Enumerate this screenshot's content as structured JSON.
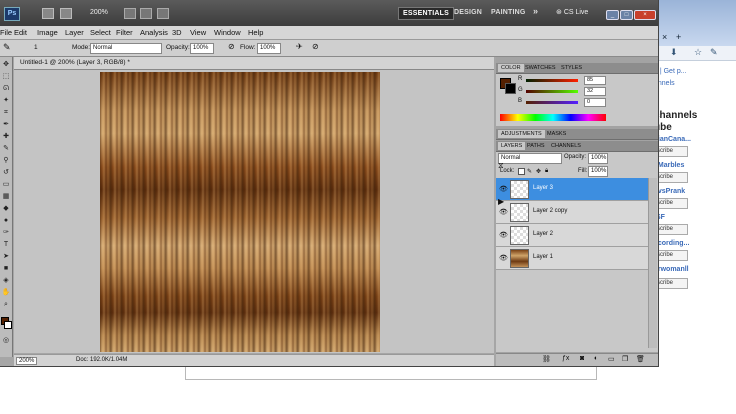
{
  "app": {
    "logo": "Ps",
    "zoom": "200%",
    "workspaces": [
      "ESSENTIALS",
      "DESIGN",
      "PAINTING"
    ],
    "more": "»",
    "cslive": "CS Live"
  },
  "menu": [
    "File",
    "Edit",
    "Image",
    "Layer",
    "Select",
    "Filter",
    "Analysis",
    "3D",
    "View",
    "Window",
    "Help"
  ],
  "options": {
    "size": "1",
    "mode_label": "Mode:",
    "mode_value": "Normal",
    "opacity_label": "Opacity:",
    "opacity_value": "100%",
    "flow_label": "Flow:",
    "flow_value": "100%"
  },
  "document": {
    "tab_title": "Untitled-1 @ 200% (Layer 3, RGB/8) *",
    "status_zoom": "200%",
    "status_doc": "Doc: 192.0K/1.04M"
  },
  "color_panel": {
    "tabs": [
      "COLOR",
      "SWATCHES",
      "STYLES"
    ],
    "r_label": "R",
    "r_value": "85",
    "g_label": "G",
    "g_value": "32",
    "b_label": "B",
    "b_value": "0",
    "foreground": "#552000"
  },
  "adjust_panel": {
    "tabs": [
      "ADJUSTMENTS",
      "MASKS"
    ]
  },
  "layers_panel": {
    "tabs": [
      "LAYERS",
      "PATHS",
      "CHANNELS"
    ],
    "blend": "Normal",
    "opacity_label": "Opacity:",
    "opacity_value": "100%",
    "lock_label": "Lock:",
    "fill_label": "Fill:",
    "fill_value": "100%",
    "layers": [
      "Layer 3",
      "Layer 2 copy",
      "Layer 2",
      "Layer 1"
    ]
  },
  "browser": {
    "stub_link": "n | Get p...",
    "stub_channels_text": "annels",
    "heading1": "channels",
    "heading2": "ube",
    "entries": [
      "sianCana...",
      "eMarbles",
      "evsPrank",
      "ISF",
      "ecording...",
      "erwomanll"
    ],
    "subscribe": "scribe"
  }
}
